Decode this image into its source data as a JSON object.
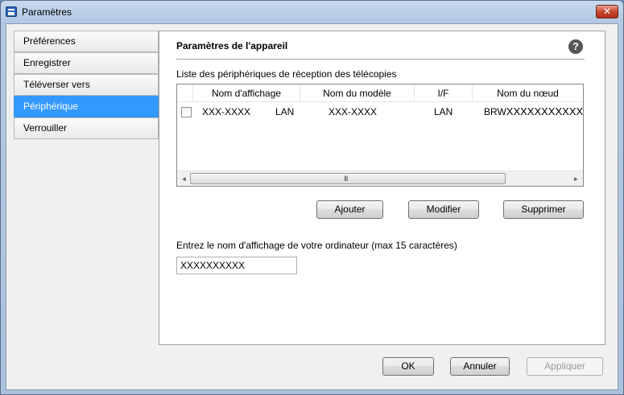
{
  "window": {
    "title": "Paramètres",
    "close_label": "✕"
  },
  "sidebar": {
    "items": [
      {
        "label": "Préférences",
        "selected": false
      },
      {
        "label": "Enregistrer",
        "selected": false
      },
      {
        "label": "Téléverser vers",
        "selected": false
      },
      {
        "label": "Périphérique",
        "selected": true
      },
      {
        "label": "Verrouiller",
        "selected": false
      }
    ]
  },
  "panel": {
    "title": "Paramètres de l'appareil",
    "help_icon": "?",
    "list_caption": "Liste des périphériques de réception des télécopies",
    "columns": [
      "Nom d'affichage",
      "Nom du modèle",
      "I/F",
      "Nom du nœud"
    ],
    "rows": [
      {
        "checked": false,
        "display_name": "XXX-XXXX",
        "display_if": "LAN",
        "model": "XXX-XXXX",
        "interface": "LAN",
        "node_prefix": "BRW",
        "node_suffix": "XXXXXXXXXXXX"
      }
    ],
    "scroll_grip": "III",
    "scroll_left": "◄",
    "scroll_right": "►",
    "buttons": {
      "add": "Ajouter",
      "edit": "Modifier",
      "delete": "Supprimer"
    },
    "name_caption": "Entrez le nom d'affichage de votre ordinateur (max 15 caractères)",
    "name_value": "XXXXXXXXXX"
  },
  "footer": {
    "ok": "OK",
    "cancel": "Annuler",
    "apply": "Appliquer"
  },
  "colors": {
    "selection": "#3399ff",
    "window_frame": "#b3c9e3",
    "close_button": "#c7452c"
  }
}
